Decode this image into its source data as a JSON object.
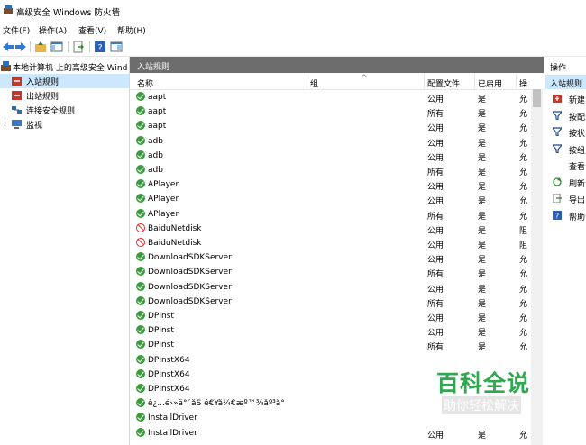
{
  "window": {
    "title": "高级安全 Windows 防火墙"
  },
  "menu": [
    "文件(F)",
    "操作(A)",
    "查看(V)",
    "帮助(H)"
  ],
  "tree": {
    "root": "本地计算机 上的高级安全 Wind",
    "items": [
      {
        "label": "入站规则",
        "selected": true
      },
      {
        "label": "出站规则",
        "selected": false
      },
      {
        "label": "连接安全规则",
        "selected": false
      },
      {
        "label": "监视",
        "selected": false
      }
    ]
  },
  "middle": {
    "header": "入站规则",
    "columns": [
      "名称",
      "组",
      "配置文件",
      "已启用",
      "操"
    ],
    "rows": [
      {
        "name": "aapt",
        "profile": "公用",
        "enabled": "是",
        "action": "允",
        "status": "allow"
      },
      {
        "name": "aapt",
        "profile": "所有",
        "enabled": "是",
        "action": "允",
        "status": "allow"
      },
      {
        "name": "aapt",
        "profile": "公用",
        "enabled": "是",
        "action": "允",
        "status": "allow"
      },
      {
        "name": "adb",
        "profile": "公用",
        "enabled": "是",
        "action": "允",
        "status": "allow"
      },
      {
        "name": "adb",
        "profile": "公用",
        "enabled": "是",
        "action": "允",
        "status": "allow"
      },
      {
        "name": "adb",
        "profile": "所有",
        "enabled": "是",
        "action": "允",
        "status": "allow"
      },
      {
        "name": "APlayer",
        "profile": "公用",
        "enabled": "是",
        "action": "允",
        "status": "allow"
      },
      {
        "name": "APlayer",
        "profile": "公用",
        "enabled": "是",
        "action": "允",
        "status": "allow"
      },
      {
        "name": "APlayer",
        "profile": "所有",
        "enabled": "是",
        "action": "允",
        "status": "allow"
      },
      {
        "name": "BaiduNetdisk",
        "profile": "公用",
        "enabled": "是",
        "action": "阻",
        "status": "block"
      },
      {
        "name": "BaiduNetdisk",
        "profile": "公用",
        "enabled": "是",
        "action": "阻",
        "status": "block"
      },
      {
        "name": "DownloadSDKServer",
        "profile": "公用",
        "enabled": "是",
        "action": "允",
        "status": "allow"
      },
      {
        "name": "DownloadSDKServer",
        "profile": "所有",
        "enabled": "是",
        "action": "允",
        "status": "allow"
      },
      {
        "name": "DownloadSDKServer",
        "profile": "公用",
        "enabled": "是",
        "action": "允",
        "status": "allow"
      },
      {
        "name": "DownloadSDKServer",
        "profile": "所有",
        "enabled": "是",
        "action": "允",
        "status": "allow"
      },
      {
        "name": "DPInst",
        "profile": "公用",
        "enabled": "是",
        "action": "允",
        "status": "allow"
      },
      {
        "name": "DPInst",
        "profile": "公用",
        "enabled": "是",
        "action": "允",
        "status": "allow"
      },
      {
        "name": "DPInst",
        "profile": "所有",
        "enabled": "是",
        "action": "允",
        "status": "allow"
      },
      {
        "name": "DPInstX64",
        "profile": "",
        "enabled": "",
        "action": "",
        "status": "allow"
      },
      {
        "name": "DPInstX64",
        "profile": "",
        "enabled": "",
        "action": "",
        "status": "allow"
      },
      {
        "name": "DPInstX64",
        "profile": "",
        "enabled": "",
        "action": "",
        "status": "allow"
      },
      {
        "name": "è¿...é›»ä°´åŠ é€Ÿå¼€æº™¾åº³å°",
        "profile": "",
        "enabled": "",
        "action": "",
        "status": "allow"
      },
      {
        "name": "InstallDriver",
        "profile": "",
        "enabled": "",
        "action": "",
        "status": "allow"
      },
      {
        "name": "InstallDriver",
        "profile": "公用",
        "enabled": "是",
        "action": "允",
        "status": "allow"
      }
    ]
  },
  "actions": {
    "header": "操作",
    "section": "入站规则",
    "items": [
      {
        "label": "新建",
        "icon": "new-rule-icon"
      },
      {
        "label": "按配",
        "icon": "filter-icon"
      },
      {
        "label": "按状",
        "icon": "filter-icon"
      },
      {
        "label": "按组",
        "icon": "filter-icon"
      },
      {
        "label": "查看",
        "icon": ""
      },
      {
        "label": "刷新",
        "icon": "refresh-icon"
      },
      {
        "label": "导出",
        "icon": "export-icon"
      },
      {
        "label": "帮助",
        "icon": "help-icon"
      }
    ]
  },
  "watermark": {
    "line1": "百科全说",
    "line2": "助你轻松解决"
  }
}
